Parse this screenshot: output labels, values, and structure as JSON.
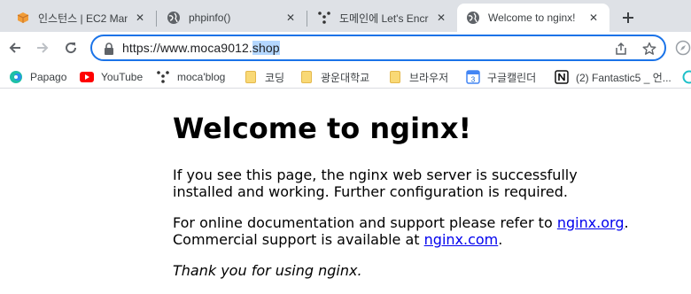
{
  "tabs": [
    {
      "title": "인스턴스 | EC2 Man",
      "favicon": "aws-box-icon",
      "active": false
    },
    {
      "title": "phpinfo()",
      "favicon": "globe-icon",
      "active": false
    },
    {
      "title": "도메인에 Let's Encr",
      "favicon": "dots-icon",
      "active": false
    },
    {
      "title": "Welcome to nginx!",
      "favicon": "globe-icon",
      "active": true
    }
  ],
  "omnibox": {
    "url_prefix": "https://www.moca9012.",
    "url_selected": "shop"
  },
  "bookmarks": [
    {
      "label": "Papago",
      "icon": "papago-icon"
    },
    {
      "label": "YouTube",
      "icon": "youtube-icon"
    },
    {
      "label": "moca'blog",
      "icon": "dots-icon"
    },
    {
      "label": "코딩",
      "icon": "folder-icon"
    },
    {
      "label": "광운대학교",
      "icon": "folder-icon"
    },
    {
      "label": "브라우저",
      "icon": "folder-icon"
    },
    {
      "label": "구글캘린더",
      "icon": "calendar-icon"
    },
    {
      "label": "(2) Fantastic5 _ 언...",
      "icon": "notion-icon"
    }
  ],
  "page": {
    "heading": "Welcome to nginx!",
    "p1": "If you see this page, the nginx web server is successfully installed and working. Further configuration is required.",
    "p2_before": "For online documentation and support please refer to ",
    "p2_link": "nginx.org",
    "p2_mid": ".",
    "p2_line2_before": "Commercial support is available at ",
    "p2_link2": "nginx.com",
    "p2_end": ".",
    "p3": "Thank you for using nginx."
  },
  "colors": {
    "accent": "#1a73e8",
    "tabstrip": "#dee1e6",
    "link": "#0000ee"
  }
}
